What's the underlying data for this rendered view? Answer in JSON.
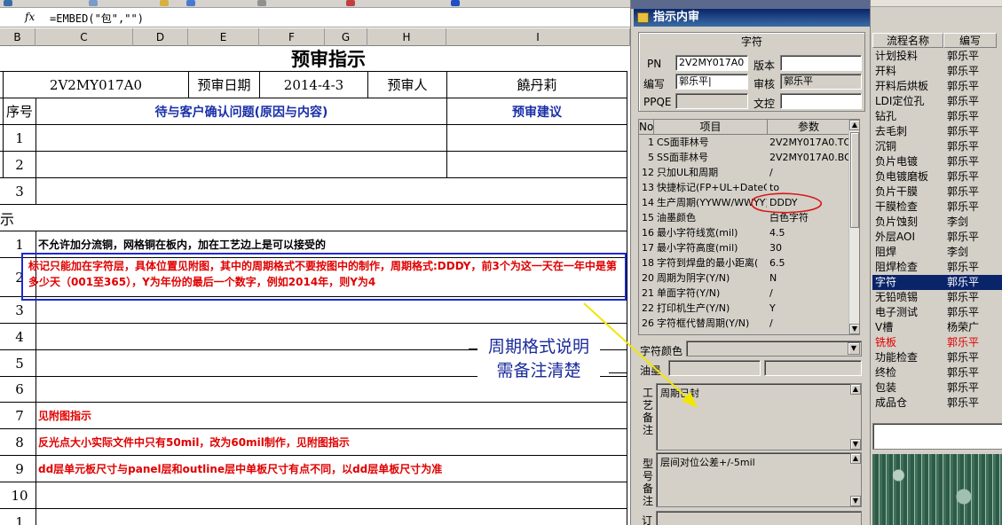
{
  "formula_bar": {
    "fx": "fx",
    "formula": "=EMBED(\"包\",\"\")"
  },
  "columns": [
    "B",
    "C",
    "D",
    "E",
    "F",
    "G",
    "H",
    "I"
  ],
  "sheet": {
    "title": "预审指示",
    "info_row": {
      "pn": "2V2MY017A0",
      "date_label": "预审日期",
      "date": "2014-4-3",
      "reviewer_label": "预审人",
      "reviewer": "饒丹莉"
    },
    "table_header": {
      "no": "序号",
      "issue": "待与客户确认问题(原因与内容)",
      "suggest": "预审建议"
    },
    "q_rows": [
      "1",
      "2",
      "3"
    ],
    "section2_label": "示",
    "instruction_rows": [
      {
        "no": "1",
        "text": "不允许加分流铜，网格铜在板内，加在工艺边上是可以接受的"
      },
      {
        "no": "2",
        "text": "标记只能加在字符层，具体位置见附图，其中的周期格式不要按图中的制作，周期格式:DDDY，前3个为这一天在一年中是第多少天（001至365），Y为年份的最后一个数字，例如2014年，则Y为4"
      },
      {
        "no": "3",
        "text": ""
      },
      {
        "no": "4",
        "text": ""
      },
      {
        "no": "5",
        "text": ""
      },
      {
        "no": "6",
        "text": ""
      },
      {
        "no": "7",
        "text": "见附图指示"
      },
      {
        "no": "8",
        "text": "反光点大小实际文件中只有50mil，改为60mil制作，见附图指示"
      },
      {
        "no": "9",
        "text": "dd层单元板尺寸与panel层和outline层中单板尺寸有点不同，以dd层单板尺寸为准"
      },
      {
        "no": "10",
        "text": ""
      },
      {
        "no": "1",
        "text": ""
      }
    ],
    "annotation": {
      "line1": "周期格式说明",
      "line2": "需备注清楚"
    }
  },
  "dialog": {
    "title": "指示内审",
    "group_label": "字符",
    "fields": {
      "pn_label": "PN",
      "pn": "2V2MY017A0",
      "version_label": "版本",
      "version": "",
      "code_label": "编写",
      "code": "郭乐平|",
      "audit_label": "审核",
      "audit": "郭乐平",
      "ppqe_label": "PPQE",
      "ppqe": "",
      "doc_label": "文控",
      "doc": ""
    },
    "param_headers": [
      "No",
      "项目",
      "参数"
    ],
    "params": [
      {
        "no": "1",
        "item": "CS面菲林号",
        "value": "2V2MY017A0.TO"
      },
      {
        "no": "5",
        "item": "SS面菲林号",
        "value": "2V2MY017A0.BO"
      },
      {
        "no": "12",
        "item": "只加UL和周期",
        "value": "/"
      },
      {
        "no": "13",
        "item": "快捷标记(FP+UL+DateCo",
        "value": "to"
      },
      {
        "no": "14",
        "item": "生产周期(YYWW/WWYY)",
        "value": "DDDY"
      },
      {
        "no": "15",
        "item": "油墨颜色",
        "value": "白色字符"
      },
      {
        "no": "16",
        "item": "最小字符线宽(mil)",
        "value": "4.5"
      },
      {
        "no": "17",
        "item": "最小字符高度(mil)",
        "value": "30"
      },
      {
        "no": "18",
        "item": "字符到焊盘的最小距离(",
        "value": "6.5"
      },
      {
        "no": "20",
        "item": "周期为阴字(Y/N)",
        "value": "N"
      },
      {
        "no": "21",
        "item": "单面字符(Y/N)",
        "value": "/"
      },
      {
        "no": "22",
        "item": "打印机生产(Y/N)",
        "value": "Y"
      },
      {
        "no": "26",
        "item": "字符框代替周期(Y/N)",
        "value": "/"
      }
    ],
    "char_color_label": "字符颜色",
    "char_color_value": "",
    "ink_label": "油墨",
    "process_label": "工艺备注",
    "process_note": "周期已封",
    "model_label": "型号备注",
    "model_note": "层间对位公差+/-5mil",
    "bottom_label": "订"
  },
  "flow": {
    "headers": [
      "流程名称",
      "编写"
    ],
    "rows": [
      {
        "name": "计划投料",
        "by": "郭乐平"
      },
      {
        "name": "开料",
        "by": "郭乐平"
      },
      {
        "name": "开料后烘板",
        "by": "郭乐平"
      },
      {
        "name": "LDI定位孔",
        "by": "郭乐平"
      },
      {
        "name": "钻孔",
        "by": "郭乐平"
      },
      {
        "name": "去毛刺",
        "by": "郭乐平"
      },
      {
        "name": "沉铜",
        "by": "郭乐平"
      },
      {
        "name": "负片电镀",
        "by": "郭乐平"
      },
      {
        "name": "负电镀磨板",
        "by": "郭乐平"
      },
      {
        "name": "负片干膜",
        "by": "郭乐平"
      },
      {
        "name": "干膜检查",
        "by": "郭乐平"
      },
      {
        "name": "负片蚀刻",
        "by": "李剑"
      },
      {
        "name": "外层AOI",
        "by": "郭乐平"
      },
      {
        "name": "阻焊",
        "by": "李剑"
      },
      {
        "name": "阻焊检查",
        "by": "郭乐平"
      },
      {
        "name": "字符",
        "by": "郭乐平"
      },
      {
        "name": "无铅喷锡",
        "by": "郭乐平"
      },
      {
        "name": "电子测试",
        "by": "郭乐平"
      },
      {
        "name": "V槽",
        "by": "杨荣广"
      },
      {
        "name": "铣板",
        "by": "郭乐平"
      },
      {
        "name": "功能检查",
        "by": "郭乐平"
      },
      {
        "name": "终检",
        "by": "郭乐平"
      },
      {
        "name": "包装",
        "by": "郭乐平"
      },
      {
        "name": "成品仓",
        "by": "郭乐平"
      }
    ],
    "selected_index": 15,
    "red_index": 19
  },
  "colors": {
    "red_text": "#e00000",
    "blue_text": "#1a2fa8",
    "highlight_box": "#1b2ad4",
    "selection": "#0a246a",
    "annotation_arrow": "#f2e600"
  }
}
